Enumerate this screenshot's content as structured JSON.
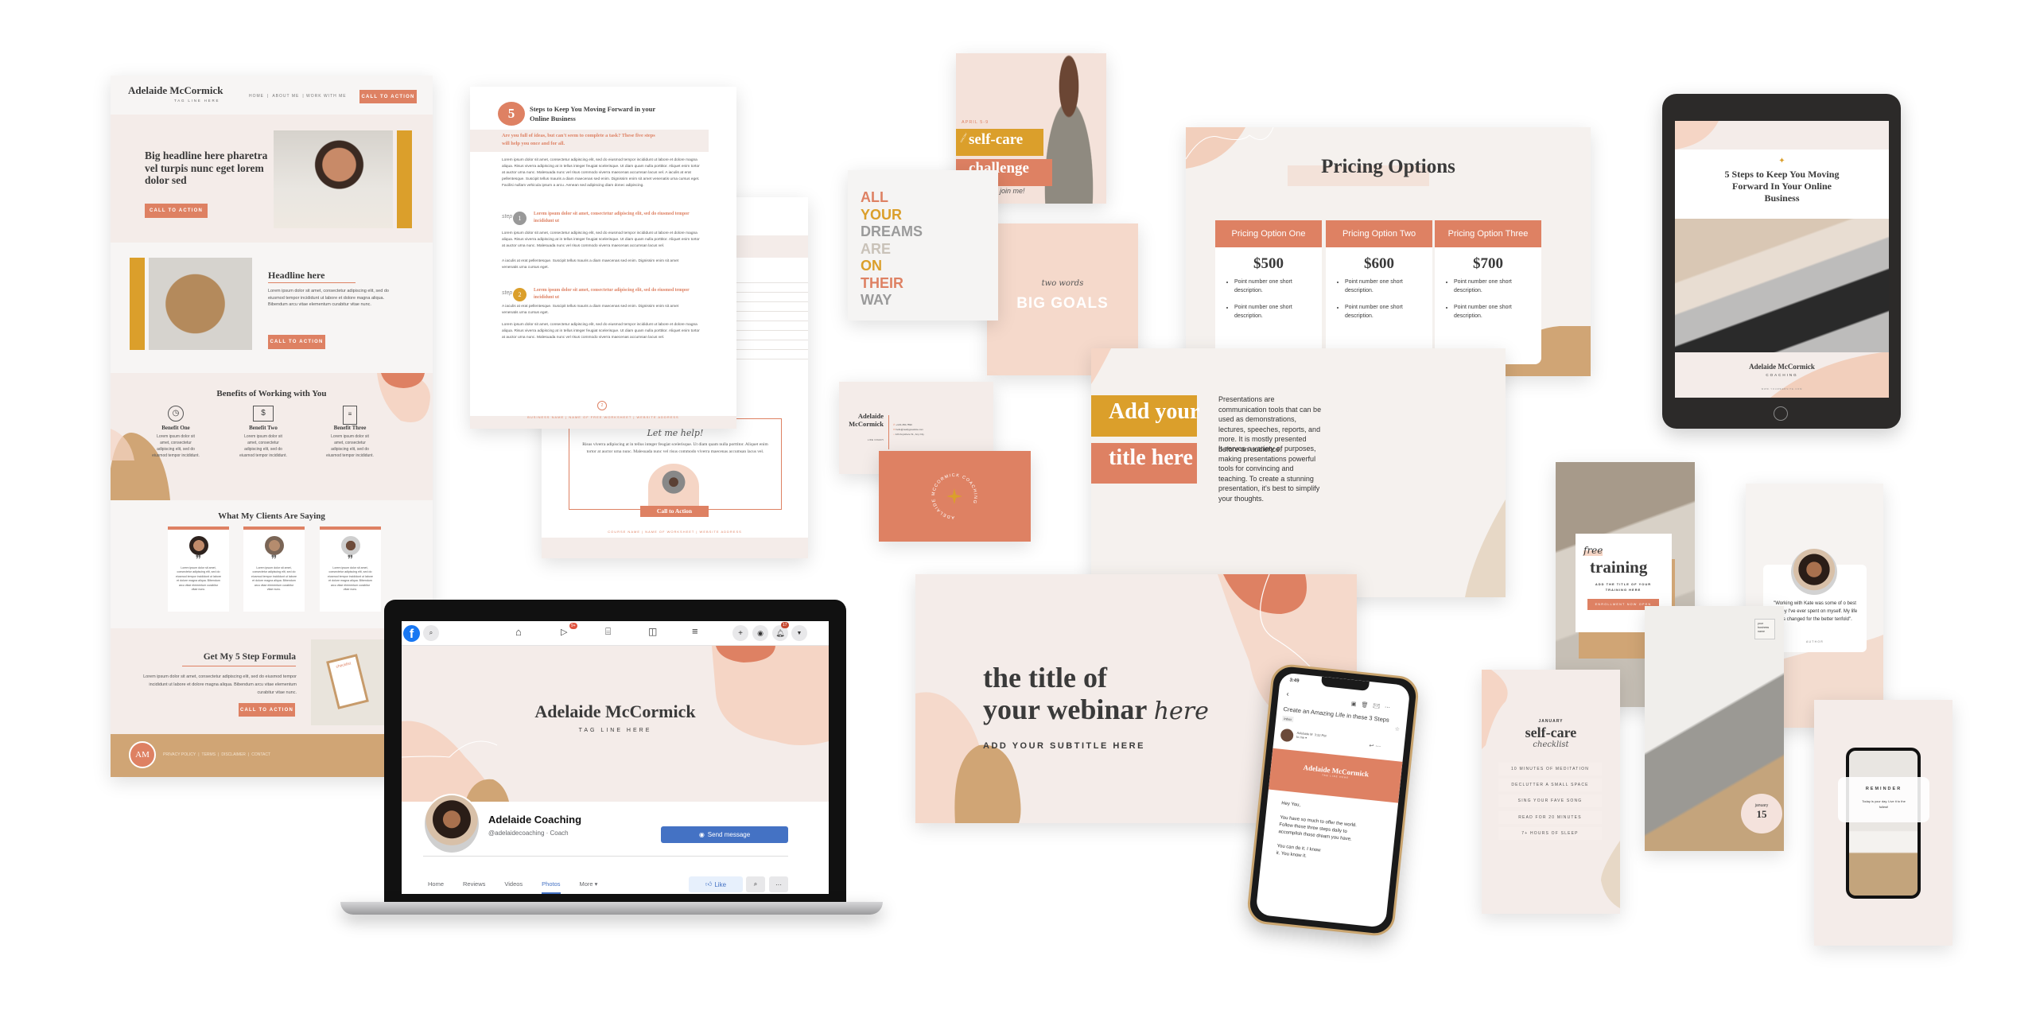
{
  "colors": {
    "terracotta": "#DE8163",
    "mustard": "#DB9F2B",
    "blush": "#F4ECE9",
    "peach": "#F5D5C5",
    "tan": "#D0A575",
    "charcoal": "#3A3A3A",
    "facebook_blue": "#4472C4"
  },
  "website": {
    "brand": "Adelaide McCormick",
    "tagline": "TAG LINE HERE",
    "nav": [
      "HOME",
      "|",
      "ABOUT ME",
      "| WORK WITH ME"
    ],
    "nav_cta": "CALL TO ACTION",
    "hero": {
      "headline": "Big headline here pharetra vel turpis nunc eget lorem dolor sed",
      "cta": "CALL TO ACTION"
    },
    "section": {
      "headline": "Headline here",
      "body": "Lorem ipsum dolor sit amet, consectetur adipiscing elit, sed do eiusmod tempor incididunt ut labore et dolore magna aliqua. Bibendum arcu vitae elementum curabitur vitae nunc.",
      "cta": "CALL TO ACTION"
    },
    "benefits": {
      "title": "Benefits of Working with You",
      "items": [
        {
          "icon": "clock-icon",
          "title": "Benefit One",
          "body": "Lorem ipsum dolor sit amet, consectetur adipiscing elit, sed do eiusmod tempor incididunt."
        },
        {
          "icon": "money-icon",
          "title": "Benefit Two",
          "body": "Lorem ipsum dolor sit amet, consectetur adipiscing elit, sed do eiusmod tempor incididunt."
        },
        {
          "icon": "document-icon",
          "title": "Benefit Three",
          "body": "Lorem ipsum dolor sit amet, consectetur adipiscing elit, sed do eiusmod tempor incididunt."
        }
      ]
    },
    "clients": {
      "title": "What My Clients Are Saying",
      "quotes": [
        "Lorem ipsum dolor sit amet, consectetur adipiscing elit, sed do eiusmod tempor incididunt ut labore et dolore magna aliqua. Bibendum arcu vitae elementum curabitur vitae nunc.",
        "Lorem ipsum dolor sit amet, consectetur adipiscing elit, sed do eiusmod tempor incididunt ut labore et dolore magna aliqua. Bibendum arcu vitae elementum curabitur vitae nunc.",
        "Lorem ipsum dolor sit amet, consectetur adipiscing elit, sed do eiusmod tempor incididunt ut labore et dolore magna aliqua. Bibendum arcu vitae elementum curabitur vitae nunc."
      ]
    },
    "formula": {
      "title": "Get My 5 Step Formula",
      "body": "Lorem ipsum dolor sit amet, consectetur adipiscing elit, sed do eiusmod tempor incididunt ut labore et dolore magna aliqua. Bibendum arcu vitae elementum curabitur vitae nunc.",
      "cta": "CALL TO ACTION",
      "clipboard": "checklist"
    },
    "footer": {
      "logo": "AM",
      "links": [
        "PRIVACY POLICY",
        "|",
        "TERMS",
        "|",
        "DISCLAIMER",
        "|",
        "CONTACT"
      ]
    }
  },
  "workbook": {
    "number": "5",
    "title": "Steps to Keep You Moving Forward in your Online Business",
    "intro": "Are you full of ideas, but can't seem to complete a task? These five steps will help you once and for all.",
    "para": "Lorem ipsum dolor sit amet, consectetur adipiscing elit, sed do eiusmod tempor incididunt ut labore et dolore magna aliqua. Risus viverra adipiscing at in tellus integer feugiat scelerisque. Ut diam quam nulla porttitor. Aliquet enim tortor at auctor urna nunc. Malesuada nunc vel risus commodo viverra maecenas accumsan lacus vel. A iaculis at erat pellentesque. Suscipit tellus mauris a diam maecenas sed enim. Dignissim enim sit amet venenatis urna cursus eget. Facilisi nullam vehicula ipsum a arcu. Aenean sed adipiscing diam donec adipiscing.",
    "steps": [
      {
        "label": "step",
        "num": "1",
        "heading": "Lorem ipsum dolor sit amet, consectetur adipiscing elit, sed do eiusmod tempor incididunt ut",
        "body1": "Lorem ipsum dolor sit amet, consectetur adipiscing elit, sed do eiusmod tempor incididunt ut labore et dolore magna aliqua. Risus viverra adipiscing at in tellus integer feugiat scelerisque. Ut diam quam nulla porttitor. Aliquet enim tortor at auctor urna nunc. Malesuada nunc vel risus commodo viverra maecenas accumsan lacus vel.",
        "body2": "A iaculis at erat pellentesque. Suscipit tellus mauris a diam maecenas sed enim. Dignissim enim sit amet venenatis urna cursus eget."
      },
      {
        "label": "step",
        "num": "2",
        "heading": "Lorem ipsum dolor sit amet, consectetur adipiscing elit, sed do eiusmod tempor incididunt ut",
        "body1": "A iaculis at erat pellentesque. Suscipit tellus mauris a diam maecenas sed enim. Dignissim enim sit amet venenatis urna cursus eget.",
        "body2": "Lorem ipsum dolor sit amet, consectetur adipiscing elit, sed do eiusmod tempor incididunt ut labore et dolore magna aliqua. Risus viverra adipiscing at in tellus integer feugiat scelerisque. Ut diam quam nulla porttitor. Aliquet enim tortor at auctor urna nunc. Malesuada nunc vel risus commodo viverra maecenas accumsan lacus vel."
      }
    ],
    "page": "2",
    "footer": "BUSINESS NAME   |   NAME OF FREE WORKSHEET   |   WEBSITE ADDRESS"
  },
  "worksheet": {
    "script": "Let me help!",
    "body": "Risus viverra adipiscing at in tellus integer feugiat scelerisque. Ut diam quam nulla porttitor. Aliquet enim tortor at auctor urna nunc. Malesuada nunc vel risus commodo viverra maecenas accumsan lacus vel.",
    "cta": "Call to Action",
    "footer": "COURSE NAME   |   NAME OF WORKSHEET   |   WEBSITE ADDRESS"
  },
  "facebook": {
    "watch_badge": "9+",
    "notif_badge": "17",
    "cover_title": "Adelaide McCormick",
    "cover_tagline": "TAG LINE HERE",
    "page_name": "Adelaide Coaching",
    "handle": "@adelaidecoaching · Coach",
    "send_message": "Send message",
    "tabs": [
      "Home",
      "Reviews",
      "Videos",
      "Photos",
      "More ▾"
    ],
    "active_tab": "Photos",
    "like": "Like",
    "more_dots": "···"
  },
  "challenge": {
    "date": "APRIL 5-9",
    "small": "FIVE DAY",
    "line1": "self-care",
    "line2": "challenge",
    "script": "join me!"
  },
  "dreams": {
    "words": [
      {
        "text": "ALL",
        "color": "#DE8163"
      },
      {
        "text": "YOUR",
        "color": "#DB9F2B"
      },
      {
        "text": "DREAMS",
        "color": "#9A9A9A"
      },
      {
        "text": "ARE",
        "color": "#C9C2B8"
      },
      {
        "text": "ON",
        "color": "#DB9F2B"
      },
      {
        "text": "THEIR",
        "color": "#DE8163"
      },
      {
        "text": "WAY",
        "color": "#9A9A9A"
      }
    ]
  },
  "goals": {
    "script": "two words",
    "title": "BIG GOALS"
  },
  "pricing": {
    "title": "Pricing Options",
    "plans": [
      {
        "name": "Pricing Option One",
        "price": "$500",
        "points": [
          "Point number one short description.",
          "Point number one short description."
        ]
      },
      {
        "name": "Pricing Option Two",
        "price": "$600",
        "points": [
          "Point number one short description.",
          "Point number one short description."
        ]
      },
      {
        "name": "Pricing Option Three",
        "price": "$700",
        "points": [
          "Point number one short description.",
          "Point number one short description."
        ]
      }
    ]
  },
  "presentation": {
    "title_line1": "Add your",
    "title_line2": "title here",
    "para1": "Presentations are communication tools that can be used as demonstrations, lectures, speeches, reports, and more. It is mostly presented before an audience.",
    "para2": "It serves a variety of purposes, making presentations powerful tools for convincing and teaching. To create a stunning presentation, it's best to simplify your thoughts."
  },
  "business_card": {
    "name_line1": "Adelaide",
    "name_line2": "McCormick",
    "role": "LIFE COACH",
    "phone": "+123-456-7890",
    "email": "hello@reallygreatsite.com",
    "address": "123 Anywhere St., Any City",
    "ring_text": "ADELAIDE MCCORMICK COACHING"
  },
  "webinar": {
    "line1": "the title of",
    "line2": "your webinar",
    "script": "here",
    "subtitle": "ADD YOUR SUBTITLE HERE"
  },
  "email_phone": {
    "time": "3:49",
    "subject": "Create an Amazing Life in these 3 Steps",
    "badge": "Inbox",
    "sender": "Adelaide M",
    "sent": "3:32 PM",
    "to": "to me ▾",
    "banner": "Adelaide McCormick",
    "banner_tag": "TAG LINE HERE",
    "greeting": "Hey You,",
    "body": "You have so much to offer the world. Follow these three steps daily to accomplish those dream you have.",
    "closing": "You can do it. I know it. You know it."
  },
  "ebook": {
    "title": "5 Steps to Keep You Moving Forward In Your Online Business",
    "author": "Adelaide McCormick",
    "sub": "COACHING",
    "url": "WWW.YOURWEBSITE.COM"
  },
  "stories": {
    "training": {
      "script": "free",
      "title": "training",
      "sub": "ADD THE TITLE OF YOUR TRAINING HERE",
      "cta": "ENROLLMENT NOW OPEN"
    },
    "testimonial": {
      "quote": "\"Working with Kate was some of o best money I've ever spent on myself. My life has changed for the better tenfold\".",
      "author": "AUTHOR"
    },
    "photo": {
      "badge": "your business name",
      "month": "january",
      "day": "15"
    },
    "checklist": {
      "month": "JANUARY",
      "title": "self-care",
      "script": "checklist",
      "items": [
        "10 MINUTES OF MEDITATION",
        "DECLUTTER A SMALL SPACE",
        "SING YOUR FAVE SONG",
        "READ FOR 20 MINUTES",
        "7+ HOURS OF SLEEP"
      ]
    },
    "reminder": {
      "title": "REMINDER",
      "body": "Today is your day. Live it to the fullest!"
    }
  }
}
